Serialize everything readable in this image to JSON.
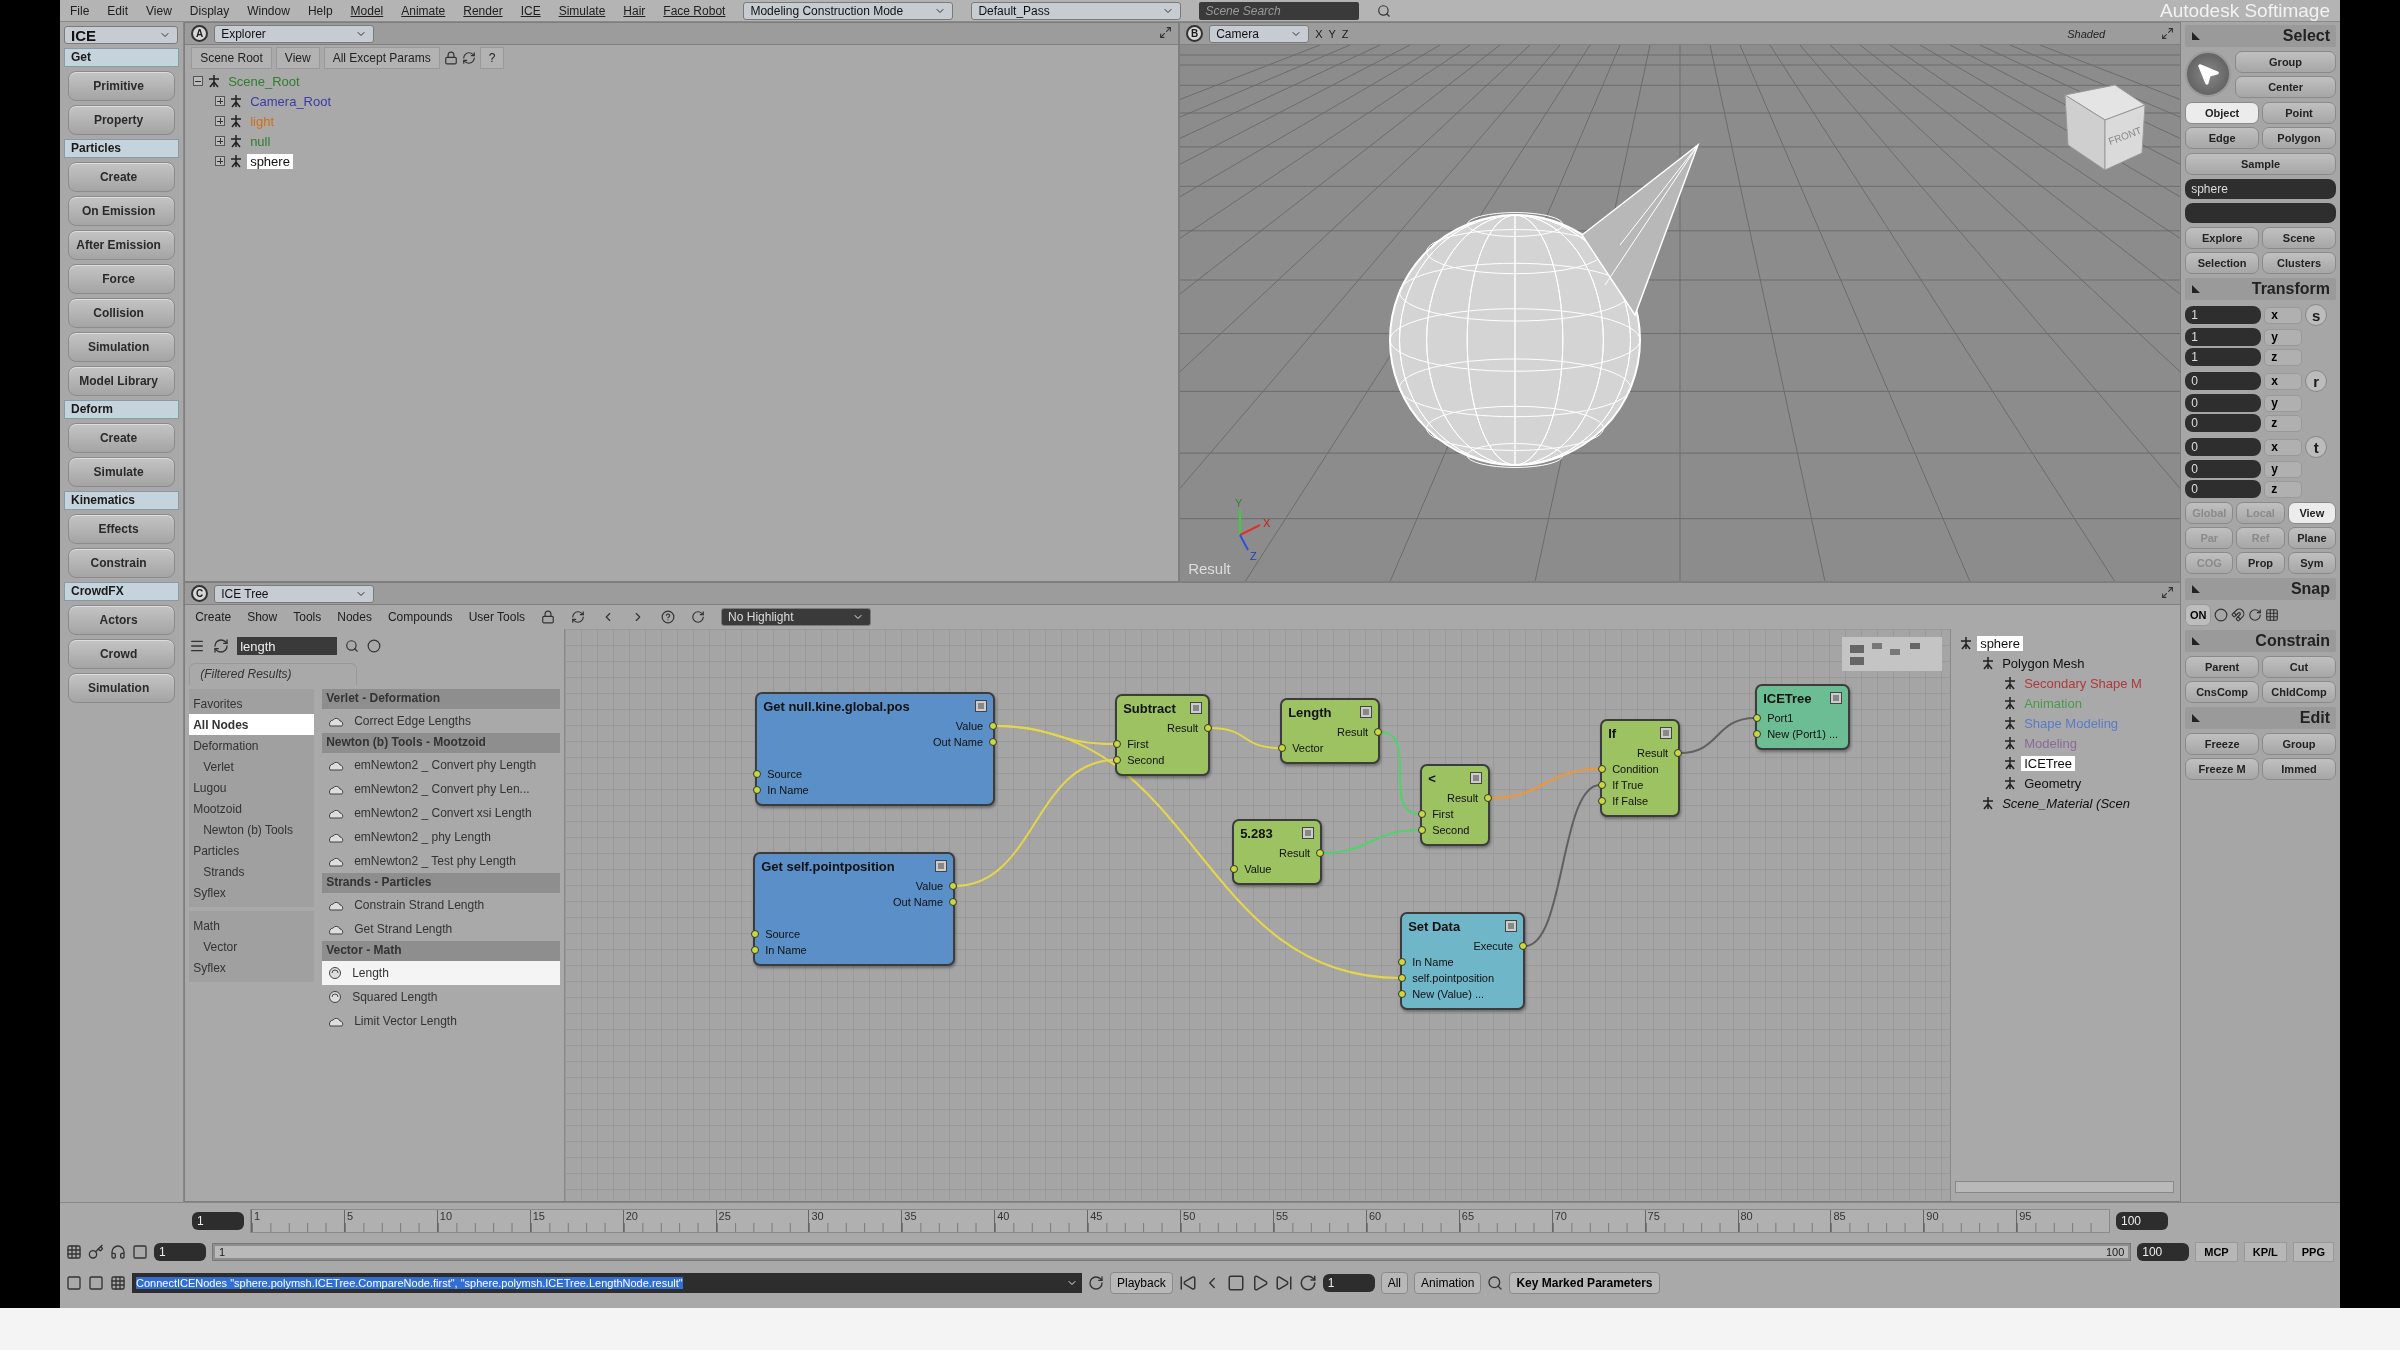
{
  "menu_bar": {
    "items": [
      "File",
      "Edit",
      "View",
      "Display",
      "Window",
      "Help"
    ],
    "modules": [
      "Model",
      "Animate",
      "Render",
      "ICE",
      "Simulate",
      "Hair",
      "Face Robot"
    ],
    "mode": "Modeling Construction Mode",
    "pass": "Default_Pass",
    "search": {
      "placeholder": "Scene Search"
    },
    "title": "Autodesk Softimage"
  },
  "toolbar": {
    "selector": "ICE",
    "sections": [
      {
        "title": "Get",
        "buttons": [
          "Primitive",
          "Property"
        ]
      },
      {
        "title": "Particles",
        "buttons": [
          "Create",
          "On Emission",
          "After Emission",
          "Force",
          "Collision",
          "Simulation",
          "Model Library"
        ]
      },
      {
        "title": "Deform",
        "buttons": [
          "Create",
          "Simulate"
        ]
      },
      {
        "title": "Kinematics",
        "buttons": [
          "Effects",
          "Constrain"
        ]
      },
      {
        "title": "CrowdFX",
        "buttons": [
          "Actors",
          "Crowd",
          "Simulation"
        ]
      }
    ]
  },
  "explorer": {
    "badge": "A",
    "title": "Explorer",
    "filters": [
      "Scene Root",
      "View",
      "All Except Params"
    ],
    "help": "?",
    "tree": [
      {
        "label": "Scene_Root",
        "color": "#2f7d2f",
        "expanded": true,
        "selected": false,
        "children": [
          {
            "label": "Camera_Root",
            "color": "#3b3ba8",
            "expanded": false,
            "selected": false
          },
          {
            "label": "light",
            "color": "#d0701c",
            "expanded": false,
            "selected": false
          },
          {
            "label": "null",
            "color": "#2f7d2f",
            "expanded": false,
            "selected": false
          },
          {
            "label": "sphere",
            "color": "#101010",
            "expanded": false,
            "selected": true
          }
        ]
      }
    ]
  },
  "viewport": {
    "badge": "B",
    "camera": "Camera",
    "axes": [
      "X",
      "Y",
      "Z"
    ],
    "shading": "Shaded",
    "view_cube": "FRONT",
    "gizmo": [
      "Y",
      "X",
      "Z"
    ],
    "label": "Result"
  },
  "select": {
    "title": "Select",
    "buttons": [
      "Group",
      "Center"
    ],
    "filters": [
      {
        "label": "Object",
        "selected": true
      },
      {
        "label": "Point",
        "selected": false
      },
      {
        "label": "Edge",
        "selected": false
      },
      {
        "label": "Polygon",
        "selected": false
      }
    ],
    "sample": "Sample",
    "name_field": "sphere",
    "views": [
      "Explore",
      "Scene",
      "Selection",
      "Clusters"
    ]
  },
  "transform": {
    "title": "Transform",
    "groups": [
      {
        "key": "s",
        "values": [
          "1",
          "1",
          "1"
        ],
        "axes": [
          "x",
          "y",
          "z"
        ]
      },
      {
        "key": "r",
        "values": [
          "0",
          "0",
          "0"
        ],
        "axes": [
          "x",
          "y",
          "z"
        ]
      },
      {
        "key": "t",
        "values": [
          "0",
          "0",
          "0"
        ],
        "axes": [
          "x",
          "y",
          "z"
        ]
      }
    ],
    "modes": [
      {
        "label": "Global",
        "disabled": true,
        "selected": false
      },
      {
        "label": "Local",
        "disabled": true,
        "selected": false
      },
      {
        "label": "View",
        "disabled": false,
        "selected": true
      },
      {
        "label": "Par",
        "disabled": true,
        "selected": false
      },
      {
        "label": "Ref",
        "disabled": true,
        "selected": false
      },
      {
        "label": "Plane",
        "disabled": false,
        "selected": false
      },
      {
        "label": "COG",
        "disabled": true,
        "selected": false
      },
      {
        "label": "Prop",
        "disabled": false,
        "selected": false
      },
      {
        "label": "Sym",
        "disabled": false,
        "selected": false
      }
    ]
  },
  "snap": {
    "title": "Snap",
    "on": "ON"
  },
  "constrain": {
    "title": "Constrain",
    "buttons": [
      "Parent",
      "Cut",
      "CnsComp",
      "ChldComp"
    ]
  },
  "edit": {
    "title": "Edit",
    "buttons": [
      "Freeze",
      "Group",
      "Freeze M",
      "Immed"
    ]
  },
  "panel_tabs": [
    "MCP",
    "KP/L",
    "PPG"
  ],
  "ice_tree": {
    "badge": "C",
    "title": "ICE Tree",
    "menu": [
      "Create",
      "Show",
      "Tools",
      "Nodes",
      "Compounds",
      "User Tools"
    ],
    "highlight": "No Highlight",
    "search": {
      "value": "length"
    },
    "filter_tab": "(Filtered Results)",
    "category_groups": [
      {
        "items": [
          {
            "label": "Favorites",
            "selected": false
          },
          {
            "label": "All Nodes",
            "selected": true
          },
          {
            "label": "Deformation",
            "selected": false,
            "children": [
              {
                "label": "Verlet",
                "selected": false
              }
            ]
          },
          {
            "label": "Lugou",
            "selected": false
          },
          {
            "label": "Mootzoid",
            "selected": false,
            "children": [
              {
                "label": "Newton (b) Tools",
                "selected": false
              }
            ]
          },
          {
            "label": "Particles",
            "selected": false,
            "children": [
              {
                "label": "Strands",
                "selected": false
              }
            ]
          },
          {
            "label": "Syflex",
            "selected": false
          }
        ]
      },
      {
        "items": [
          {
            "label": "Math",
            "selected": false,
            "children": [
              {
                "label": "Vector",
                "selected": false
              }
            ]
          },
          {
            "label": "Syflex",
            "selected": false
          }
        ]
      }
    ],
    "results": [
      {
        "group": "Verlet - Deformation",
        "items": [
          {
            "label": "Correct Edge Lengths",
            "kind": "compound",
            "selected": false
          }
        ]
      },
      {
        "group": "Newton (b) Tools - Mootzoid",
        "items": [
          {
            "label": "emNewton2 _ Convert phy Length",
            "kind": "compound",
            "selected": false
          },
          {
            "label": "emNewton2 _ Convert phy Len...",
            "kind": "compound",
            "selected": false
          },
          {
            "label": "emNewton2 _ Convert xsi Length",
            "kind": "compound",
            "selected": false
          },
          {
            "label": "emNewton2 _ phy Length",
            "kind": "compound",
            "selected": false
          },
          {
            "label": "emNewton2 _ Test phy Length",
            "kind": "compound",
            "selected": false
          }
        ]
      },
      {
        "group": "Strands - Particles",
        "items": [
          {
            "label": "Constrain Strand Length",
            "kind": "compound",
            "selected": false
          },
          {
            "label": "Get Strand Length",
            "kind": "compound",
            "selected": false
          }
        ]
      },
      {
        "group": "Vector - Math",
        "items": [
          {
            "label": "Length",
            "kind": "node",
            "selected": true
          },
          {
            "label": "Squared Length",
            "kind": "node",
            "selected": false
          },
          {
            "label": "Limit Vector Length",
            "kind": "compound",
            "selected": false
          }
        ]
      }
    ],
    "nodes": [
      {
        "title": "Get null.kine.global.pos",
        "color": "#5a8fc8",
        "outputs": [
          "Value",
          "Out Name"
        ],
        "inputs": [
          "Source",
          "In Name"
        ]
      },
      {
        "title": "Get self.pointposition",
        "color": "#5a8fc8",
        "outputs": [
          "Value",
          "Out Name"
        ],
        "inputs": [
          "Source",
          "In Name"
        ]
      },
      {
        "title": "Subtract",
        "color": "#9cc262",
        "outputs": [
          "Result"
        ],
        "inputs": [
          "First",
          "Second"
        ]
      },
      {
        "title": "Length",
        "color": "#9cc262",
        "outputs": [
          "Result"
        ],
        "inputs": [
          "Vector"
        ]
      },
      {
        "title": "5.283",
        "color": "#9cc262",
        "outputs": [
          "Result"
        ],
        "inputs": [
          "Value"
        ]
      },
      {
        "title": "<",
        "color": "#9cc262",
        "outputs": [
          "Result"
        ],
        "inputs": [
          "First",
          "Second"
        ]
      },
      {
        "title": "Set Data",
        "color": "#6fb6c8",
        "outputs": [
          "Execute"
        ],
        "inputs": [
          "In Name",
          "self.pointposition",
          "New (Value) ..."
        ]
      },
      {
        "title": "If",
        "color": "#9cc262",
        "outputs": [
          "Result"
        ],
        "inputs": [
          "Condition",
          "If True",
          "If False"
        ]
      },
      {
        "title": "ICETree",
        "color": "#6cbc94",
        "inputs": [
          "Port1",
          "New (Port1) ..."
        ]
      }
    ],
    "scene_tree": [
      {
        "label": "sphere",
        "color": "#101010",
        "selected": true,
        "children": [
          {
            "label": "Polygon Mesh",
            "color": "#101010",
            "selected": false,
            "children": [
              {
                "label": "Secondary Shape M",
                "color": "#b03a3a",
                "selected": false
              },
              {
                "label": "Animation",
                "color": "#4a9a4a",
                "selected": false
              },
              {
                "label": "Shape Modeling",
                "color": "#5a7ac8",
                "selected": false
              },
              {
                "label": "Modeling",
                "color": "#8a6a9a",
                "selected": false
              },
              {
                "label": "ICETree",
                "color": "#101010",
                "selected": true
              },
              {
                "label": "Geometry",
                "color": "#101010",
                "selected": false
              }
            ]
          },
          {
            "label": "Scene_Material (Scen",
            "color": "#101010",
            "selected": false
          }
        ]
      }
    ]
  },
  "timeline": {
    "start": "1",
    "ruler": [
      "1",
      "5",
      "10",
      "15",
      "20",
      "25",
      "30",
      "35",
      "40",
      "45",
      "50",
      "55",
      "60",
      "65",
      "70",
      "75",
      "80",
      "85",
      "90",
      "95"
    ],
    "end": "100",
    "range_start": "1",
    "range": {
      "start_label": "1",
      "end_label": "100",
      "level": 1
    },
    "range_end": "100"
  },
  "command_bar": {
    "command": "ConnectICENodes \"sphere.polymsh.ICETree.CompareNode.first\", \"sphere.polymsh.ICETree.LengthNode.result\"",
    "playback": "Playback",
    "frame": "1",
    "all": "All",
    "animation": "Animation",
    "keys": "Key Marked Parameters"
  }
}
